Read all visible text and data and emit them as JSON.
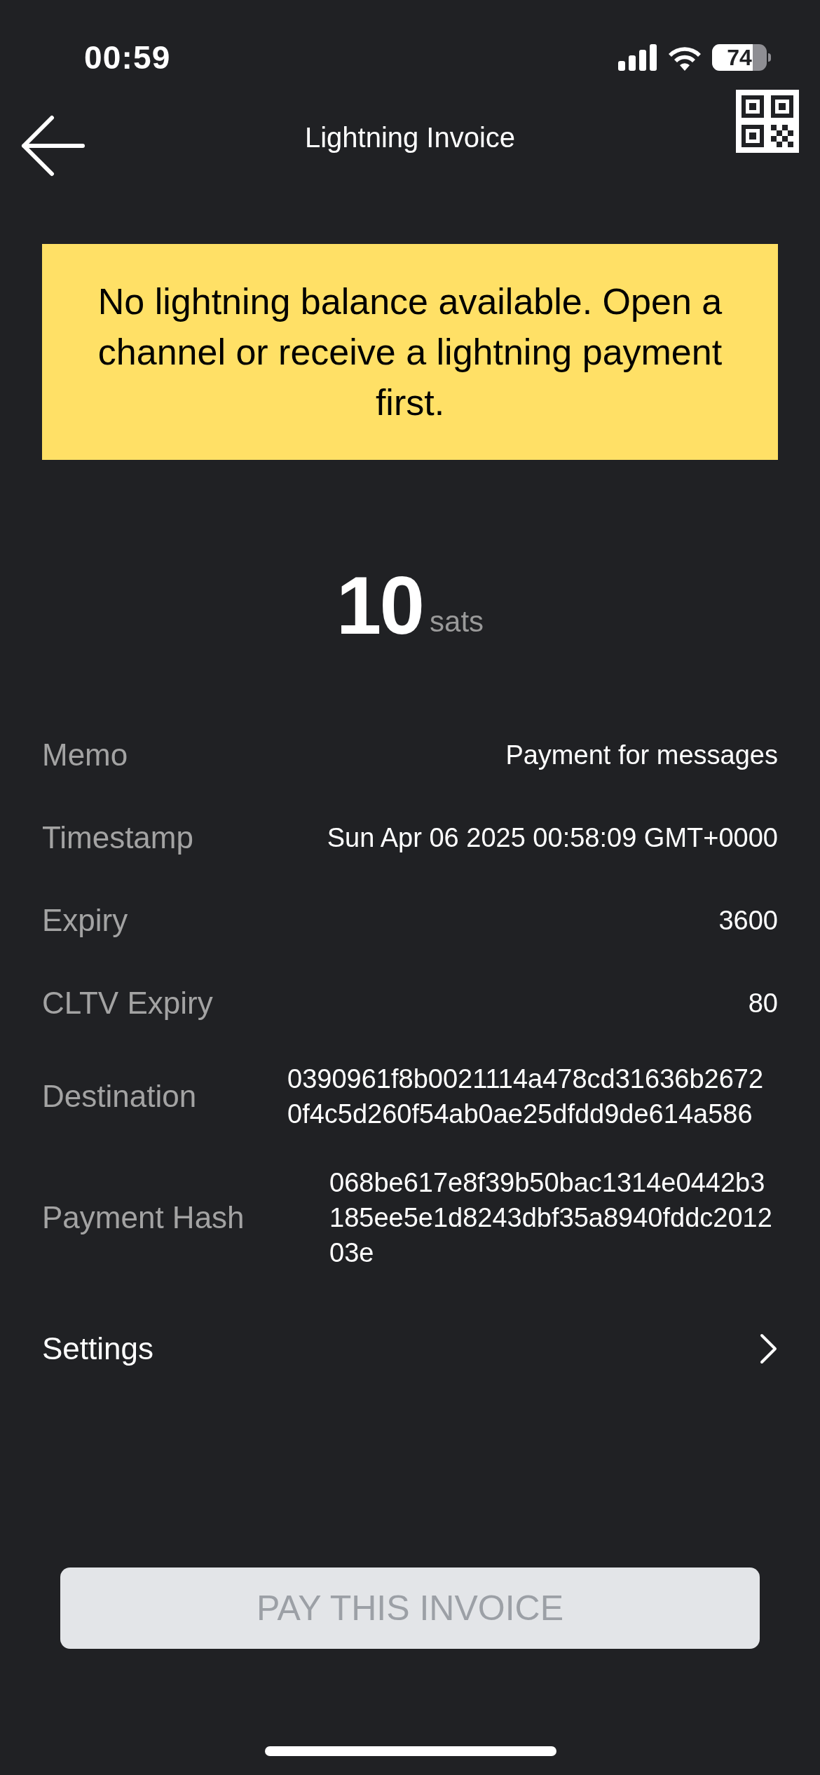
{
  "status_bar": {
    "time": "00:59",
    "battery": "74"
  },
  "header": {
    "title": "Lightning Invoice"
  },
  "banner": {
    "text": "No lightning balance available. Open a channel or receive a lightning payment first."
  },
  "amount": {
    "value": "10",
    "unit": "sats"
  },
  "details": [
    {
      "label": "Memo",
      "value": "Payment for messages"
    },
    {
      "label": "Timestamp",
      "value": "Sun Apr 06 2025 00:58:09 GMT+0000"
    },
    {
      "label": "Expiry",
      "value": "3600"
    },
    {
      "label": "CLTV Expiry",
      "value": "80"
    },
    {
      "label": "Destination",
      "value": "0390961f8b0021114a478cd31636b26720f4c5d260f54ab0ae25dfdd9de614a586"
    },
    {
      "label": "Payment Hash",
      "value": "068be617e8f39b50bac1314e0442b3185ee5e1d8243dbf35a8940fddc201203e"
    }
  ],
  "settings": {
    "label": "Settings"
  },
  "pay_button": {
    "label": "PAY THIS INVOICE",
    "disabled": true
  }
}
